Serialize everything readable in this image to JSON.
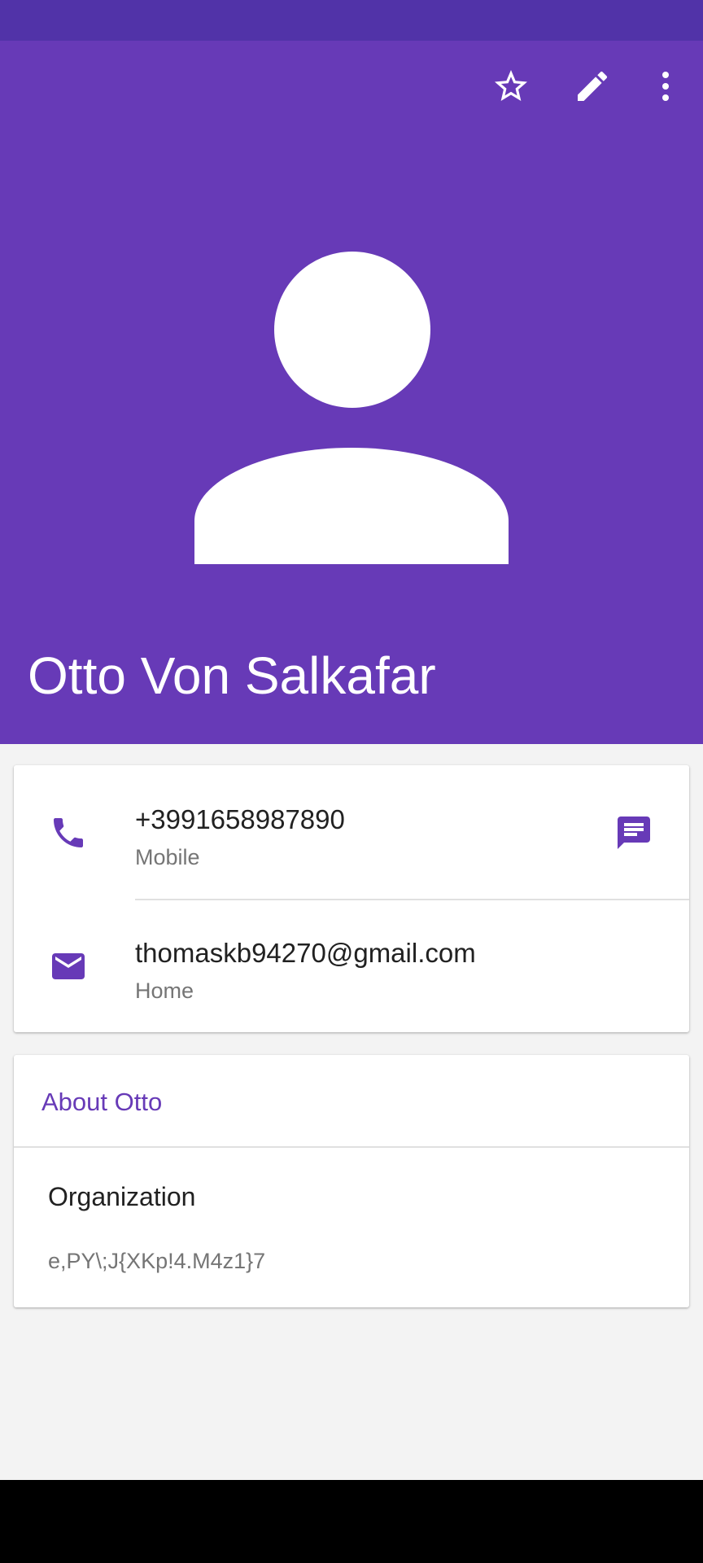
{
  "colors": {
    "status_bar": "#5133a8",
    "header": "#673ab7",
    "accent": "#673ab7",
    "background": "#f3f3f3",
    "card": "#ffffff",
    "nav_bar": "#000000"
  },
  "toolbar": {
    "icons": [
      "star-outline-icon",
      "edit-pencil-icon",
      "more-vert-icon"
    ]
  },
  "contact": {
    "name": "Otto Von Salkafar",
    "avatar_icon": "person-placeholder-icon"
  },
  "details": {
    "phone": {
      "number": "+3991658987890",
      "type": "Mobile",
      "icon": "phone-icon",
      "action_icon": "message-icon"
    },
    "email": {
      "address": "thomaskb94270@gmail.com",
      "type": "Home",
      "icon": "email-icon"
    }
  },
  "about": {
    "title": "About Otto",
    "organization_label": "Organization",
    "organization_value": "e,PY\\;J{XKp!4.M4z1}7"
  }
}
